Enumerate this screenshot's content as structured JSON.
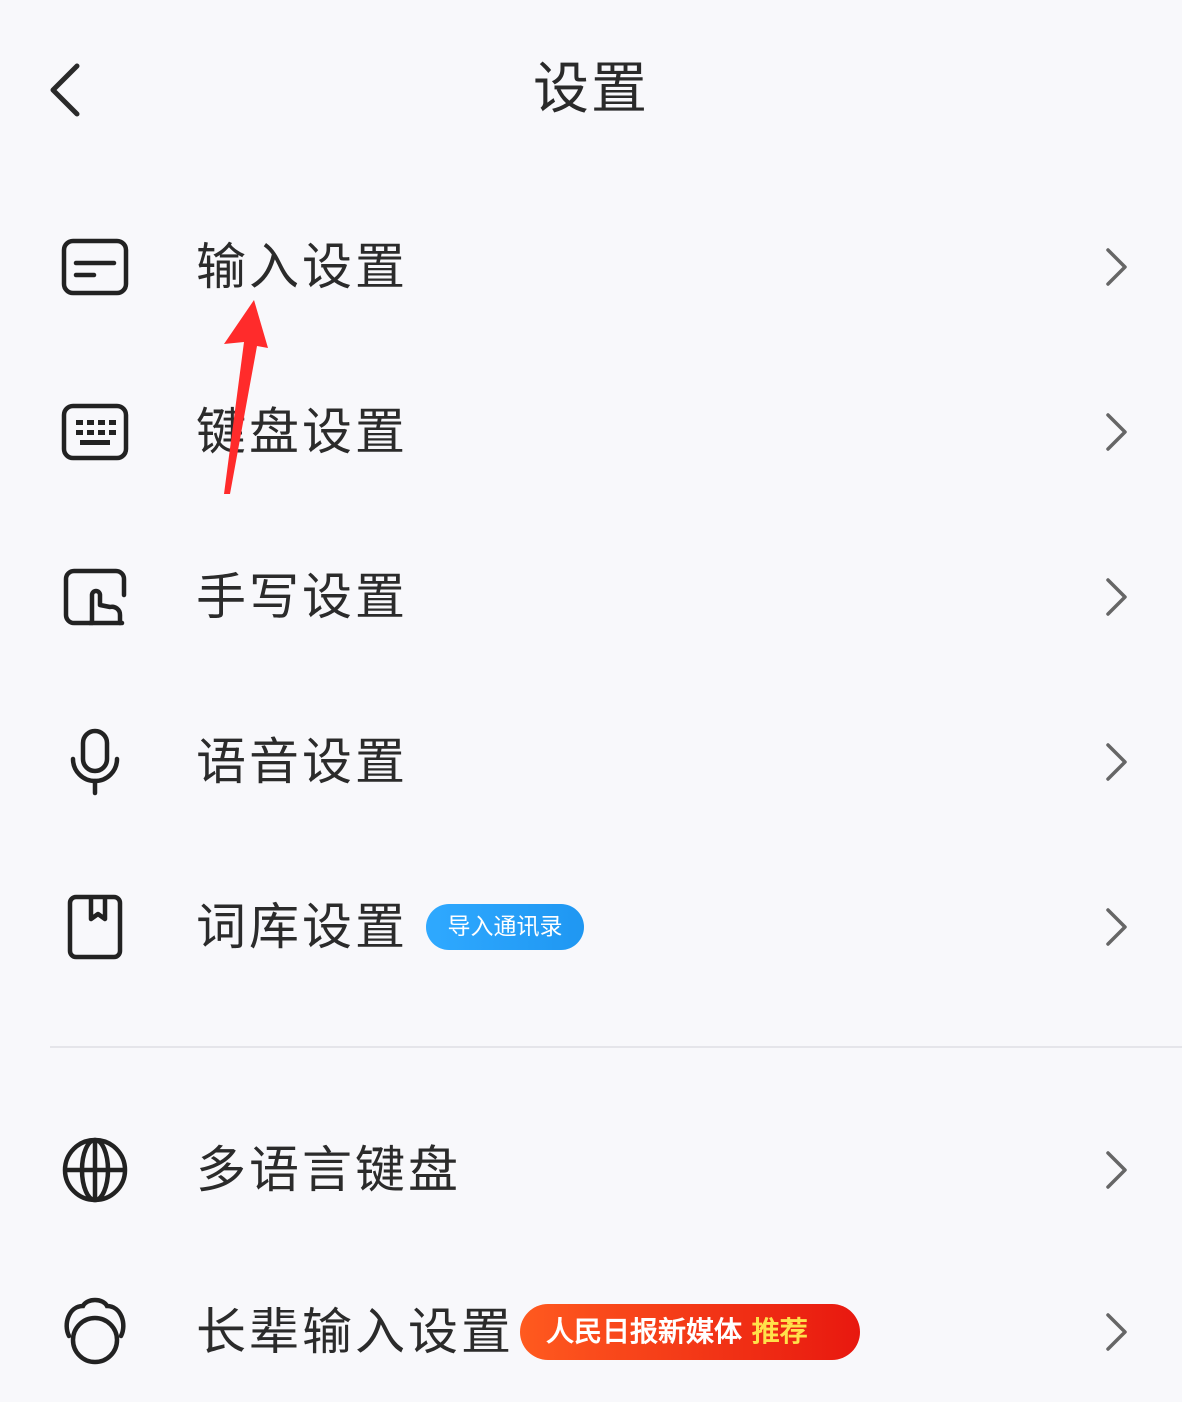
{
  "header": {
    "title": "设置"
  },
  "menu": [
    {
      "label": "输入设置",
      "icon": "input-settings-icon"
    },
    {
      "label": "键盘设置",
      "icon": "keyboard-icon"
    },
    {
      "label": "手写设置",
      "icon": "handwriting-icon"
    },
    {
      "label": "语音设置",
      "icon": "microphone-icon"
    },
    {
      "label": "词库设置",
      "icon": "lexicon-book-icon",
      "badge": "导入通讯录"
    },
    {
      "label": "多语言键盘",
      "icon": "globe-icon"
    },
    {
      "label": "长辈输入设置",
      "icon": "elder-avatar-icon",
      "badge_main": "人民日报新媒体",
      "badge_highlight": "推荐"
    }
  ],
  "colors": {
    "background": "#f8f8fb",
    "text": "#2b2b2b",
    "blue_badge": "#2fa9ff",
    "red_badge": "#e8180f",
    "annotation_arrow": "#ff2b2b"
  }
}
